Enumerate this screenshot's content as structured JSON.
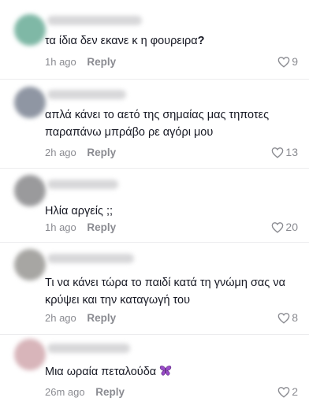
{
  "comments": [
    {
      "text": "τα ίδια δεν εκανε κ η φουρειρα",
      "text_suffix": "?",
      "time": "1h ago",
      "reply_label": "Reply",
      "likes": "9",
      "avatar_color": "#7fb8a6"
    },
    {
      "text_line1": "απλά κάνει το αετό της σημαίας μας τηποτες",
      "text_line2": "παραπάνω μπράβο ρε αγόρι μου",
      "time": "2h ago",
      "reply_label": "Reply",
      "likes": "13",
      "avatar_color": "#8f96a3"
    },
    {
      "text": "Ηλία αργείς ;;",
      "time": "1h ago",
      "reply_label": "Reply",
      "likes": "20",
      "avatar_color": "#9a9a9c"
    },
    {
      "text_line1": "Τι να κάνει τώρα το παιδί κατά τη γνώμη σας να",
      "text_line2": "κρύψει και την καταγωγή του",
      "time": "2h ago",
      "reply_label": "Reply",
      "likes": "8",
      "avatar_color": "#a7a6a3"
    },
    {
      "text": "Μια ωραία πεταλούδα",
      "emoji": "butterfly-emoji",
      "time": "26m ago",
      "reply_label": "Reply",
      "likes": "2",
      "avatar_color": "#d8b5ba"
    }
  ],
  "colors": {
    "text": "#161823",
    "meta": "#8a8b91",
    "divider": "#ececee"
  }
}
